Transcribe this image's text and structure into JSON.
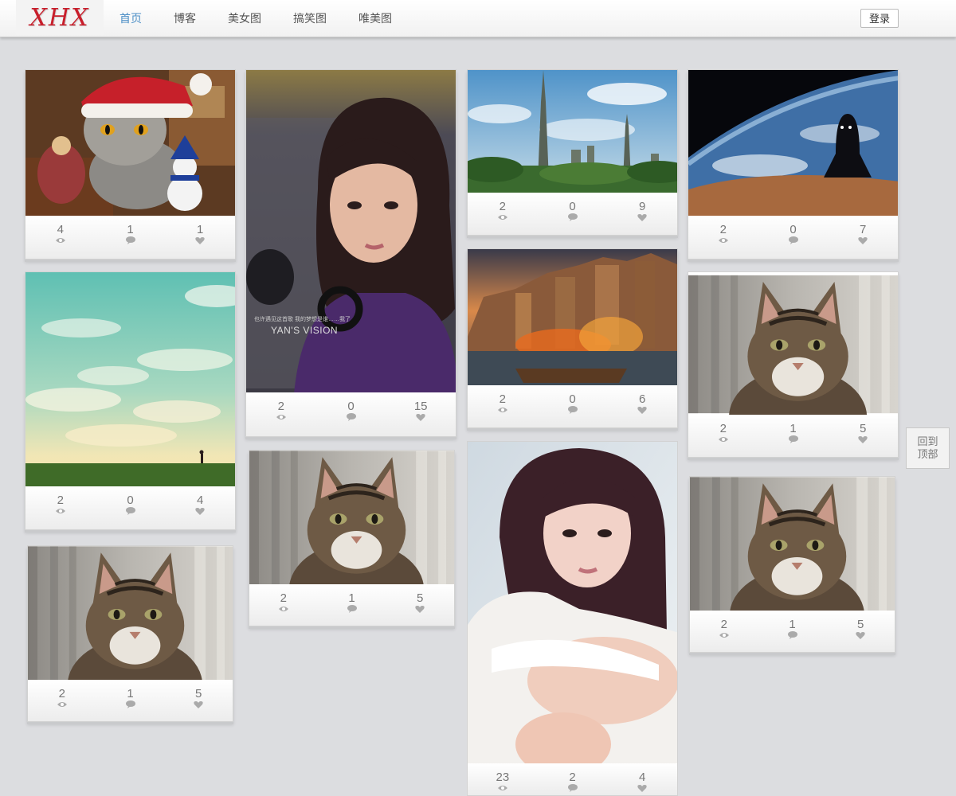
{
  "logo": {
    "text": "XHX"
  },
  "nav": {
    "items": [
      {
        "label": "首页",
        "active": true
      },
      {
        "label": "博客",
        "active": false
      },
      {
        "label": "美女图",
        "active": false
      },
      {
        "label": "搞笑图",
        "active": false
      },
      {
        "label": "唯美图",
        "active": false
      }
    ],
    "login_label": "登录"
  },
  "back_to_top": {
    "line1": "回到",
    "line2": "顶部"
  },
  "icons": {
    "views": "eye-icon",
    "comments": "comment-bubble-icon",
    "likes": "heart-icon"
  },
  "colors": {
    "nav_active": "#4d8fc6",
    "logo": "#c81e2b",
    "background": "#dcdde0"
  },
  "cards": [
    {
      "subject": "christmas-cat",
      "views": "4",
      "comments": "1",
      "likes": "1"
    },
    {
      "subject": "sky-field",
      "views": "2",
      "comments": "0",
      "likes": "4"
    },
    {
      "subject": "tabby-cat",
      "views": "2",
      "comments": "1",
      "likes": "5"
    },
    {
      "subject": "girl-portrait",
      "views": "2",
      "comments": "0",
      "likes": "15",
      "overlay_small": "也许遇见这首歌 我的梦想是谁……我了",
      "overlay_big": "YAN'S VISION"
    },
    {
      "subject": "tabby-cat",
      "views": "2",
      "comments": "1",
      "likes": "5"
    },
    {
      "subject": "fantasy-tower-city",
      "views": "2",
      "comments": "0",
      "likes": "9"
    },
    {
      "subject": "burning-city",
      "views": "2",
      "comments": "0",
      "likes": "6"
    },
    {
      "subject": "girl-white-sweater",
      "views": "23",
      "comments": "2",
      "likes": "4"
    },
    {
      "subject": "earth-from-space",
      "views": "2",
      "comments": "0",
      "likes": "7"
    },
    {
      "subject": "tabby-cat",
      "views": "2",
      "comments": "1",
      "likes": "5"
    },
    {
      "subject": "tabby-cat",
      "views": "2",
      "comments": "1",
      "likes": "5"
    }
  ]
}
